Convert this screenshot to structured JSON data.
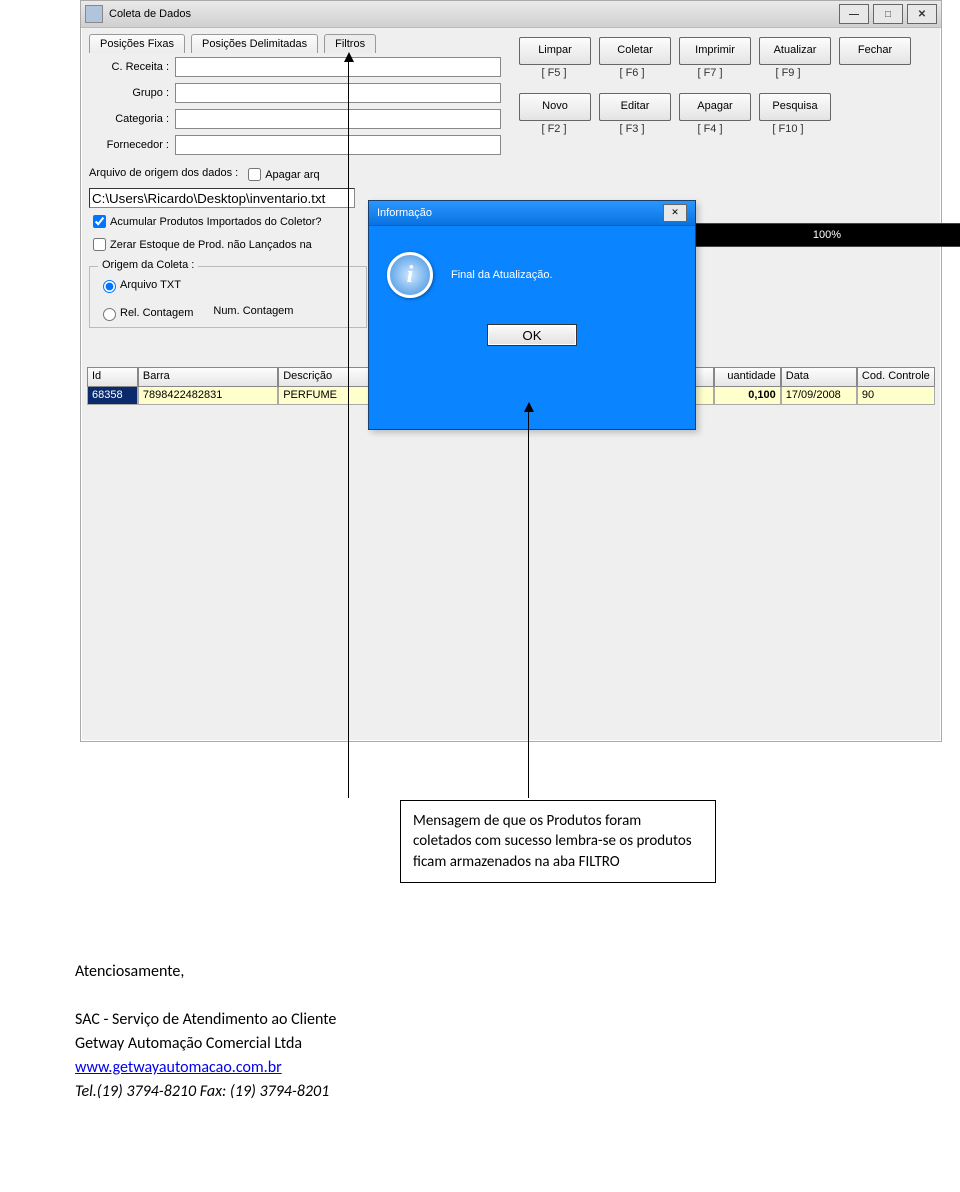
{
  "window": {
    "title": "Coleta de Dados",
    "minimize_glyph": "—",
    "maximize_glyph": "□",
    "close_glyph": "✕"
  },
  "tabs": {
    "t0": "Posições Fixas",
    "t1": "Posições Delimitadas",
    "t2": "Filtros"
  },
  "filters": {
    "creceita_label": "C. Receita :",
    "grupo_label": "Grupo :",
    "categoria_label": "Categoria :",
    "fornecedor_label": "Fornecedor :"
  },
  "buttons": {
    "limpar": "Limpar",
    "coletar": "Coletar",
    "imprimir": "Imprimir",
    "atualizar": "Atualizar",
    "fechar": "Fechar",
    "novo": "Novo",
    "editar": "Editar",
    "apagar": "Apagar",
    "pesquisa": "Pesquisa",
    "f5": "[ F5 ]",
    "f6": "[ F6 ]",
    "f7": "[ F7 ]",
    "f9": "[ F9 ]",
    "f2": "[ F2 ]",
    "f3": "[ F3 ]",
    "f4": "[ F4 ]",
    "f10": "[ F10 ]"
  },
  "origin": {
    "label_origem": "Arquivo de origem dos dados :",
    "check_apagar": "Apagar arq",
    "path": "C:\\Users\\Ricardo\\Desktop\\inventario.txt",
    "check_acum": "Acumular Produtos Importados do Coletor?",
    "check_zerar": "Zerar Estoque de Prod. não Lançados na",
    "group_label": "Origem da Coleta :",
    "radio_txt": "Arquivo TXT",
    "radio_rel": "Rel. Contagem",
    "num_cont": "Num. Contagem"
  },
  "progress": {
    "text": "100%"
  },
  "grid": {
    "h_id": "Id",
    "h_barra": "Barra",
    "h_desc": "Descrição",
    "h_qtd": "uantidade",
    "h_data": "Data",
    "h_cod": "Cod. Controle",
    "r0": {
      "id": "68358",
      "barra": "7898422482831",
      "desc": "PERFUME",
      "qtd": "0,100",
      "data": "17/09/2008",
      "cod": "90"
    }
  },
  "modal": {
    "title": "Informação",
    "msg": "Final da Atualização.",
    "ok": "OK",
    "close_glyph": "✕"
  },
  "annotation": {
    "text": "Mensagem de que os Produtos foram coletados com sucesso lembra-se os produtos ficam armazenados na aba FILTRO"
  },
  "doc": {
    "atencoes": "Atenciosamente,",
    "sac": "SAC - Serviço de Atendimento ao Cliente",
    "company": "Getway Automação Comercial Ltda",
    "url": "www.getwayautomacao.com.br",
    "tel": "Tel.(19) 3794-8210       Fax: (19) 3794-8201"
  }
}
